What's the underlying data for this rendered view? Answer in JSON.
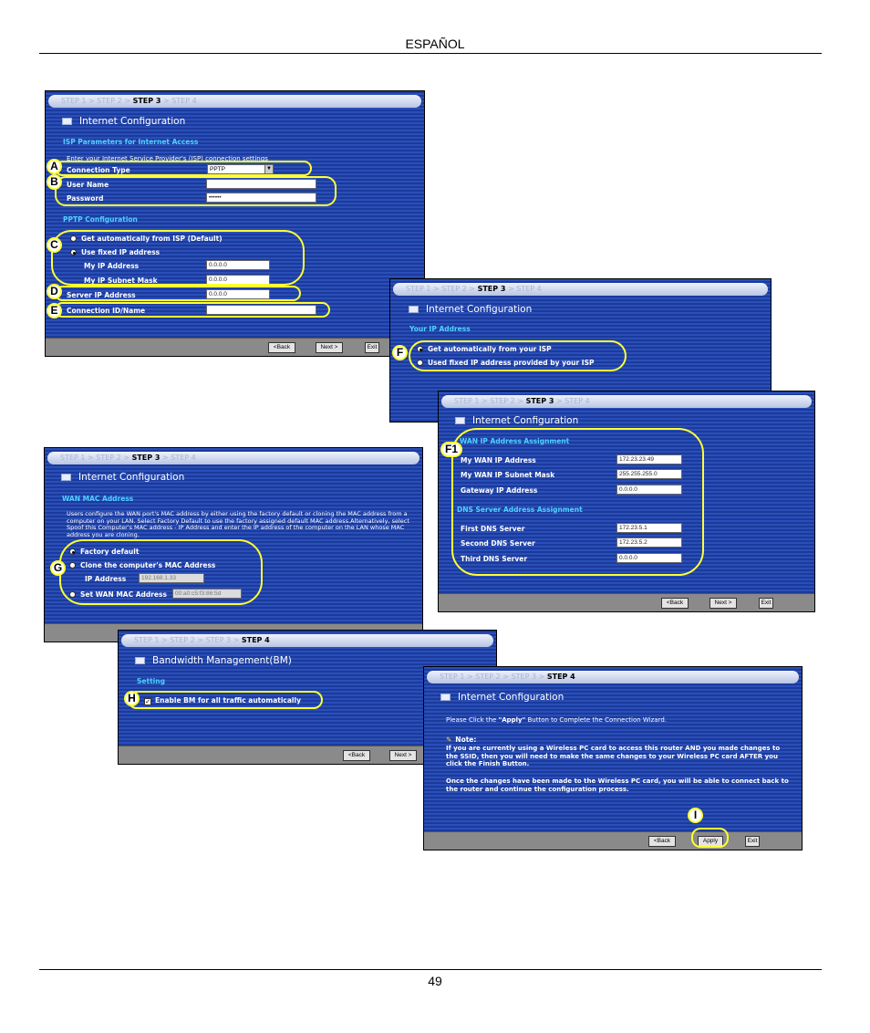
{
  "header": {
    "language": "ESPAÑOL"
  },
  "footer": {
    "page_number": "49"
  },
  "steps": {
    "s1": "STEP 1",
    "s2": "STEP 2",
    "s3": "STEP 3",
    "s4": "STEP 4",
    "sep": " > "
  },
  "panel_isp": {
    "title": "Internet Configuration",
    "section_isp": "ISP Parameters for Internet Access",
    "intro": "Enter your Internet Service Provider's (ISP) connection settings",
    "connection_type_label": "Connection Type",
    "connection_type_value": "PPTP",
    "user_name_label": "User Name",
    "password_label": "Password",
    "password_value": "••••••",
    "section_pptp": "PPTP Configuration",
    "opt_auto": "Get automatically from ISP (Default)",
    "opt_fixed": "Use fixed IP address",
    "my_ip_label": "My IP Address",
    "my_ip_value": "0.0.0.0",
    "my_mask_label": "My IP Subnet Mask",
    "my_mask_value": "0.0.0.0",
    "server_ip_label": "Server IP Address",
    "server_ip_value": "0.0.0.0",
    "conn_id_label": "Connection ID/Name",
    "back": "<Back",
    "next": "Next >",
    "exit": "Exit"
  },
  "panel_yourip": {
    "title": "Internet Configuration",
    "section": "Your IP Address",
    "opt_auto": "Get automatically from your ISP",
    "opt_fixed": "Used fixed IP address provided by your ISP"
  },
  "panel_wanip": {
    "title": "Internet Configuration",
    "section_wan": "WAN IP Address Assignment",
    "wan_ip_label": "My WAN IP Address",
    "wan_ip_value": "172.23.23.49",
    "wan_mask_label": "My WAN IP Subnet Mask",
    "wan_mask_value": "255.255.255.0",
    "gateway_label": "Gateway IP Address",
    "gateway_value": "0.0.0.0",
    "section_dns": "DNS Server Address Assignment",
    "dns1_label": "First DNS Server",
    "dns1_value": "172.23.5.1",
    "dns2_label": "Second DNS Server",
    "dns2_value": "172.23.5.2",
    "dns3_label": "Third DNS Server",
    "dns3_value": "0.0.0.0",
    "back": "<Back",
    "next": "Next >",
    "exit": "Exit"
  },
  "panel_mac": {
    "title": "Internet Configuration",
    "section": "WAN MAC Address",
    "intro": "Users configure the WAN port's MAC address by either using the factory default or cloning the MAC address from a computer on your LAN. Select Factory Default to use the factory assigned default MAC address.Alternatively, select Spoof this Computer's MAC address - IP Address and enter the IP address of the computer on the LAN whose MAC address you are cloning.",
    "opt_factory": "Factory default",
    "opt_clone": "Clone the computer's MAC Address",
    "ip_label": "IP Address",
    "ip_value": "192.168.1.33",
    "opt_set": "Set WAN MAC Address",
    "mac_value": "00:a0:c5:f3:86:5d"
  },
  "panel_bm": {
    "title": "Bandwidth Management(BM)",
    "section": "Setting",
    "enable": "Enable BM for all traffic automatically",
    "back": "<Back",
    "next": "Next >"
  },
  "panel_finish": {
    "title": "Internet Configuration",
    "intro_pre": "Please Click the ",
    "intro_apply": "\"Apply\"",
    "intro_post": " Button to Complete the Connection Wizard.",
    "note_label": "Note:",
    "note_text": "If you are currently using a Wireless PC card to access this router AND you made changes to the SSID, then you will need to make the same changes to your Wireless PC card AFTER you click the Finish Button.",
    "note_text2": "Once the changes have been made to the Wireless PC card, you will be able to connect back to the router and continue the configuration process.",
    "back": "<Back",
    "apply": "Apply",
    "exit": "Exit"
  },
  "callouts": {
    "a": "A",
    "b": "B",
    "c": "C",
    "d": "D",
    "e": "E",
    "f": "F",
    "f1": "F1",
    "g": "G",
    "h": "H",
    "i": "I"
  },
  "colors": {
    "panel_blue": "#1b3a9c",
    "section_cyan": "#4fd1ff",
    "callout_yellow": "#ffff33"
  }
}
